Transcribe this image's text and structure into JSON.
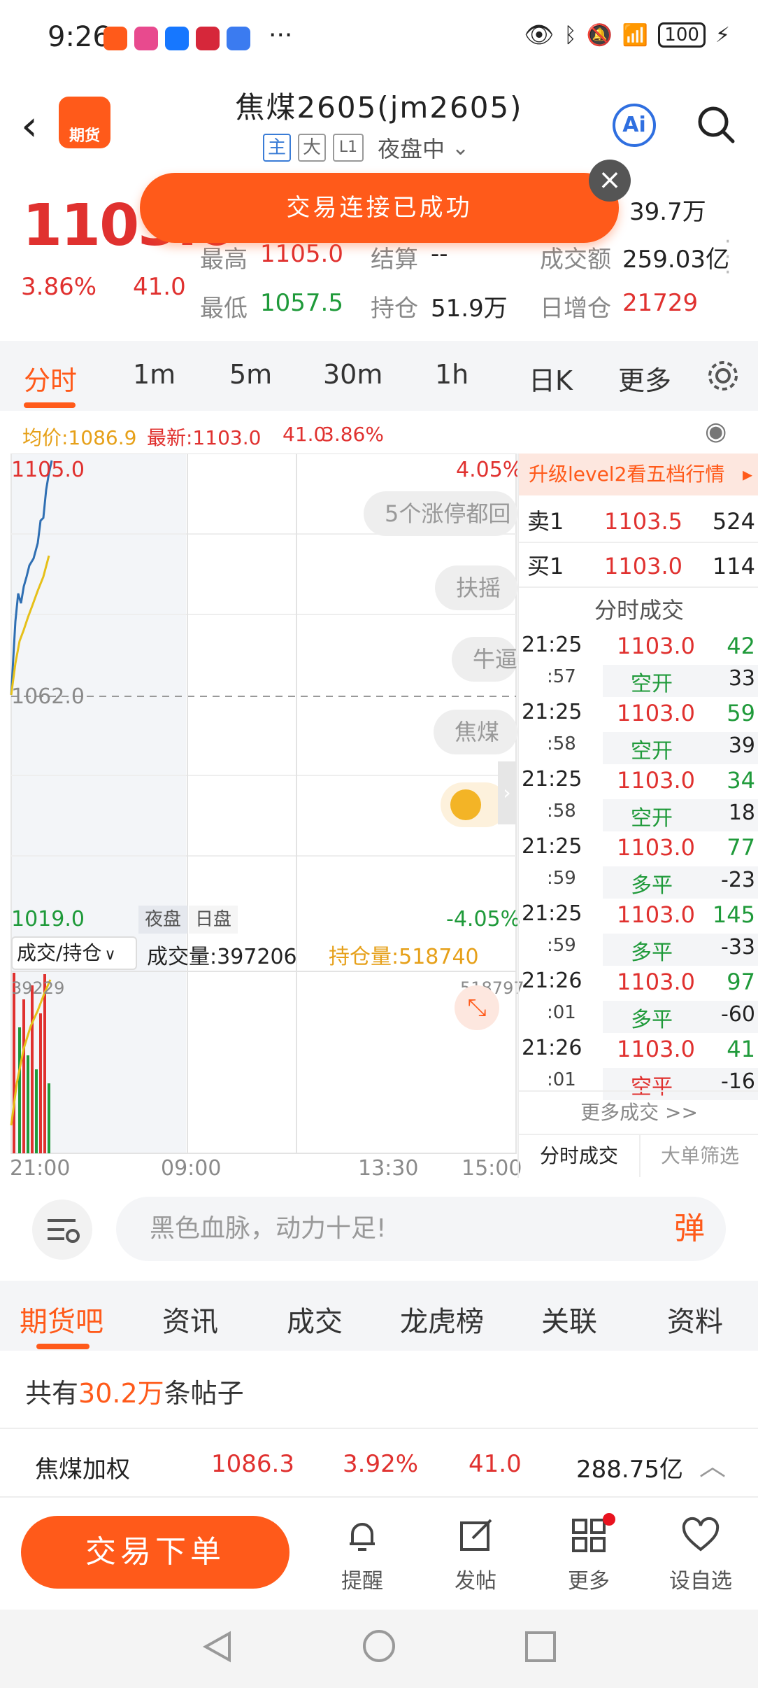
{
  "status": {
    "time": "9:26",
    "more": "···",
    "battery": "100"
  },
  "header": {
    "back": "‹",
    "logo_text": "期货",
    "title": "焦煤2605(jm2605)",
    "tags": [
      "主",
      "大",
      "L1"
    ],
    "session": "夜盘中",
    "ai": "Ai"
  },
  "quote": {
    "price": "1103.0",
    "pct": "3.86%",
    "chg": "41.0",
    "vol_value": "39.7万",
    "high_label": "最高",
    "high_value": "1105.0",
    "settle_label": "结算",
    "settle_value": "--",
    "turnover_label": "成交额",
    "turnover_value": "259.03亿",
    "low_label": "最低",
    "low_value": "1057.5",
    "oi_label": "持仓",
    "oi_value": "51.9万",
    "daily_label": "日增仓",
    "daily_value": "21729"
  },
  "toast": {
    "text": "交易连接已成功",
    "close": "×"
  },
  "tabs": [
    "分时",
    "1m",
    "5m",
    "30m",
    "1h",
    "日K",
    "更多"
  ],
  "avgline": {
    "avg": "均价:1086.9",
    "latest": "最新:1103.0",
    "chg": "41.0",
    "pct": "3.86%"
  },
  "chart": {
    "top_price": "1105.0",
    "top_pct": "4.05%",
    "mid_price": "1062.0",
    "bottom_price": "1019.0",
    "bottom_pct": "-4.05%",
    "session_night": "夜盘",
    "session_day": "日盘",
    "sub_selector": "成交/持仓",
    "volume_label": "成交量:397206",
    "oi_label": "持仓量:518740",
    "sub_left": "39229",
    "sub_right": "518797",
    "times": [
      "21:00",
      "09:00",
      "13:30",
      "15:00"
    ]
  },
  "comments": [
    "5个涨停都回",
    "扶摇",
    "牛逼",
    "焦煤"
  ],
  "side": {
    "banner": "升级level2看五档行情",
    "sell_label": "卖1",
    "sell_price": "1103.5",
    "sell_vol": "524",
    "buy_label": "买1",
    "buy_price": "1103.0",
    "buy_vol": "114",
    "ticks_title": "分时成交",
    "ticks": [
      {
        "t1": "21:25",
        "t2": ":57",
        "price": "1103.0",
        "vol": "42",
        "type": "空开",
        "oi": "33",
        "type_color": "green"
      },
      {
        "t1": "21:25",
        "t2": ":58",
        "price": "1103.0",
        "vol": "59",
        "type": "空开",
        "oi": "39",
        "type_color": "green"
      },
      {
        "t1": "21:25",
        "t2": ":58",
        "price": "1103.0",
        "vol": "34",
        "type": "空开",
        "oi": "18",
        "type_color": "green"
      },
      {
        "t1": "21:25",
        "t2": ":59",
        "price": "1103.0",
        "vol": "77",
        "type": "多平",
        "oi": "-23",
        "type_color": "green"
      },
      {
        "t1": "21:25",
        "t2": ":59",
        "price": "1103.0",
        "vol": "145",
        "type": "多平",
        "oi": "-33",
        "type_color": "green"
      },
      {
        "t1": "21:26",
        "t2": ":01",
        "price": "1103.0",
        "vol": "97",
        "type": "多平",
        "oi": "-60",
        "type_color": "green"
      },
      {
        "t1": "21:26",
        "t2": ":01",
        "price": "1103.0",
        "vol": "41",
        "type": "空平",
        "oi": "-16",
        "type_color": "red"
      }
    ],
    "more": "更多成交 >>",
    "tab1": "分时成交",
    "tab2": "大单筛选"
  },
  "chat": {
    "placeholder": "黑色血脉，动力十足!",
    "dan": "弹"
  },
  "forum_tabs": [
    "期货吧",
    "资讯",
    "成交",
    "龙虎榜",
    "关联",
    "资料"
  ],
  "posts": {
    "prefix": "共有",
    "count": "30.2万",
    "suffix": "条帖子"
  },
  "ticker": {
    "name": "焦煤加权",
    "price": "1086.3",
    "pct": "3.92%",
    "chg": "41.0",
    "amount": "288.75亿"
  },
  "bottom": {
    "trade": "交易下单",
    "remind": "提醒",
    "post": "发帖",
    "more": "更多",
    "watch": "设自选"
  },
  "colors": {
    "accent": "#ff5a1a",
    "up": "#e0312f",
    "down": "#1f9a3a",
    "avg": "#e6a019",
    "price_line": "#2f6fb3"
  }
}
